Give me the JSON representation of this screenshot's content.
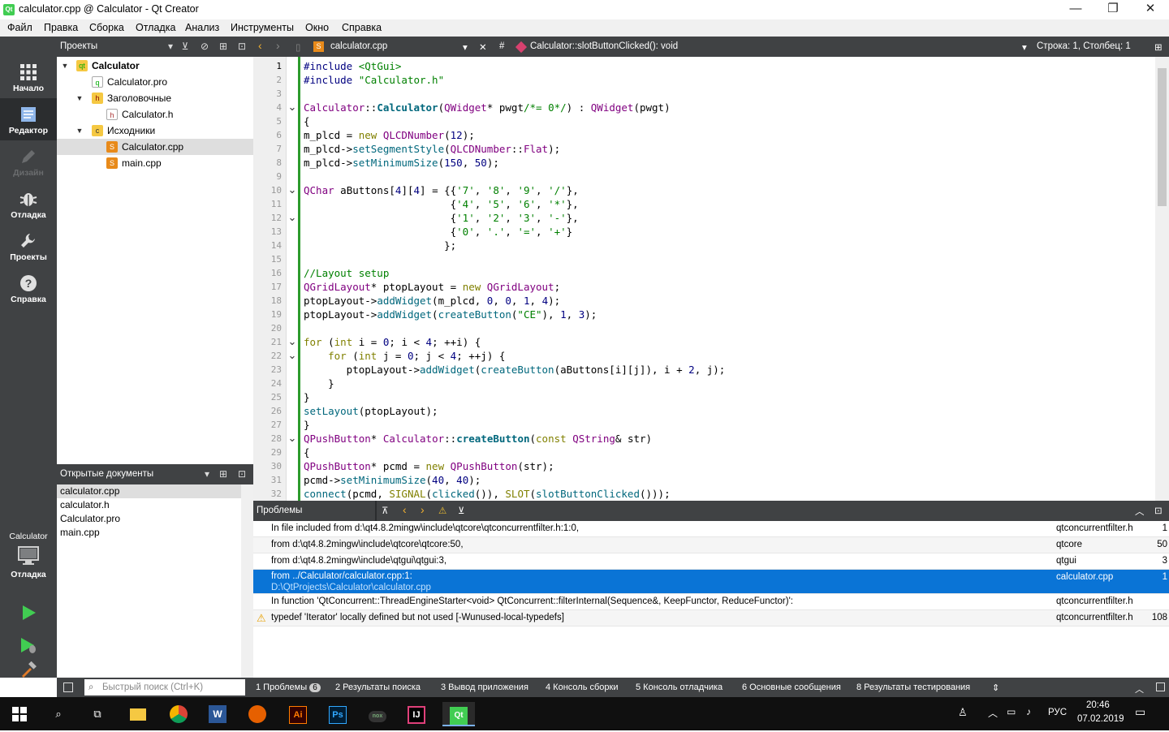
{
  "window": {
    "title": "calculator.cpp @ Calculator - Qt Creator",
    "app_icon": "Qt"
  },
  "menu": [
    "Файл",
    "Правка",
    "Сборка",
    "Отладка",
    "Анализ",
    "Инструменты",
    "Окно",
    "Справка"
  ],
  "modes": [
    {
      "label": "Начало",
      "icon": "grid-icon"
    },
    {
      "label": "Редактор",
      "icon": "editor-icon"
    },
    {
      "label": "Дизайн",
      "icon": "pen-icon"
    },
    {
      "label": "Отладка",
      "icon": "bug-icon"
    },
    {
      "label": "Проекты",
      "icon": "wrench-icon"
    },
    {
      "label": "Справка",
      "icon": "help-icon"
    }
  ],
  "kit": {
    "project": "Calculator",
    "config": "Отладка"
  },
  "projects": {
    "header": "Проекты",
    "tree": [
      {
        "label": "Calculator",
        "bold": true
      },
      {
        "label": "Calculator.pro"
      },
      {
        "label": "Заголовочные"
      },
      {
        "label": "Calculator.h"
      },
      {
        "label": "Исходники"
      },
      {
        "label": "Calculator.cpp"
      },
      {
        "label": "main.cpp"
      }
    ]
  },
  "open_docs": {
    "header": "Открытые документы",
    "items": [
      "calculator.cpp",
      "calculator.h",
      "Calculator.pro",
      "main.cpp"
    ]
  },
  "editor": {
    "file": "calculator.cpp",
    "hash": "#",
    "symbol": "Calculator::slotButtonClicked(): void",
    "position": "Строка: 1, Столбец: 1",
    "current_line": 1,
    "lines": [
      "#include <QtGui>",
      "#include \"Calculator.h\"",
      "",
      "Calculator::Calculator(QWidget* pwgt/*= 0*/) : QWidget(pwgt)",
      "{",
      "m_plcd = new QLCDNumber(12);",
      "m_plcd->setSegmentStyle(QLCDNumber::Flat);",
      "m_plcd->setMinimumSize(150, 50);",
      "",
      "QChar aButtons[4][4] = {{'7', '8', '9', '/'},",
      "                        {'4', '5', '6', '*'},",
      "                        {'1', '2', '3', '-'},",
      "                        {'0', '.', '=', '+'}",
      "                       };",
      "",
      "//Layout setup",
      "QGridLayout* ptopLayout = new QGridLayout;",
      "ptopLayout->addWidget(m_plcd, 0, 0, 1, 4);",
      "ptopLayout->addWidget(createButton(\"CE\"), 1, 3);",
      "",
      "for (int i = 0; i < 4; ++i) {",
      "    for (int j = 0; j < 4; ++j) {",
      "       ptopLayout->addWidget(createButton(aButtons[i][j]), i + 2, j);",
      "    }",
      "}",
      "setLayout(ptopLayout);",
      "}",
      "QPushButton* Calculator::createButton(const QString& str)",
      "{",
      "QPushButton* pcmd = new QPushButton(str);",
      "pcmd->setMinimumSize(40, 40);",
      "connect(pcmd, SIGNAL(clicked()), SLOT(slotButtonClicked()));"
    ],
    "fold_lines": [
      4,
      10,
      12,
      21,
      22,
      28
    ]
  },
  "problems": {
    "header": "Проблемы",
    "rows": [
      {
        "desc": "In file included from d:\\qt4.8.2mingw\\include\\qtcore\\qtconcurrentfilter.h:1:0,",
        "file": "qtconcurrentfilter.h",
        "line": "1"
      },
      {
        "desc": "from d:\\qt4.8.2mingw\\include\\qtcore\\qtcore:50,",
        "file": "qtcore",
        "line": "50"
      },
      {
        "desc": "from d:\\qt4.8.2mingw\\include\\qtgui\\qtgui:3,",
        "file": "qtgui",
        "line": "3"
      },
      {
        "desc": "from ../Calculator/calculator.cpp:1:",
        "desc2": "D:\\QtProjects\\Calculator\\calculator.cpp",
        "file": "calculator.cpp",
        "line": "1",
        "selected": true
      },
      {
        "desc": "In function 'QtConcurrent::ThreadEngineStarter<void> QtConcurrent::filterInternal(Sequence&, KeepFunctor, ReduceFunctor)':",
        "file": "qtconcurrentfilter.h",
        "line": ""
      },
      {
        "desc": "typedef 'Iterator' locally defined but not used [-Wunused-local-typedefs]",
        "file": "qtconcurrentfilter.h",
        "line": "108",
        "warning": true
      }
    ]
  },
  "status": {
    "search_placeholder": "Быстрый поиск (Ctrl+K)",
    "tabs": [
      "1  Проблемы",
      "2  Результаты поиска",
      "3  Вывод приложения",
      "4  Консоль сборки",
      "5  Консоль отладчика",
      "6  Основные сообщения",
      "8  Результаты тестирования"
    ],
    "problems_count": "6"
  },
  "taskbar": {
    "lang": "РУС",
    "time": "20:46",
    "date": "07.02.2019"
  },
  "colors": {
    "keyword": "#808000",
    "type": "#800080",
    "string": "#008000",
    "comment": "#008000",
    "number": "#000080",
    "func": "#00677c",
    "accent": "#0a74d6"
  }
}
